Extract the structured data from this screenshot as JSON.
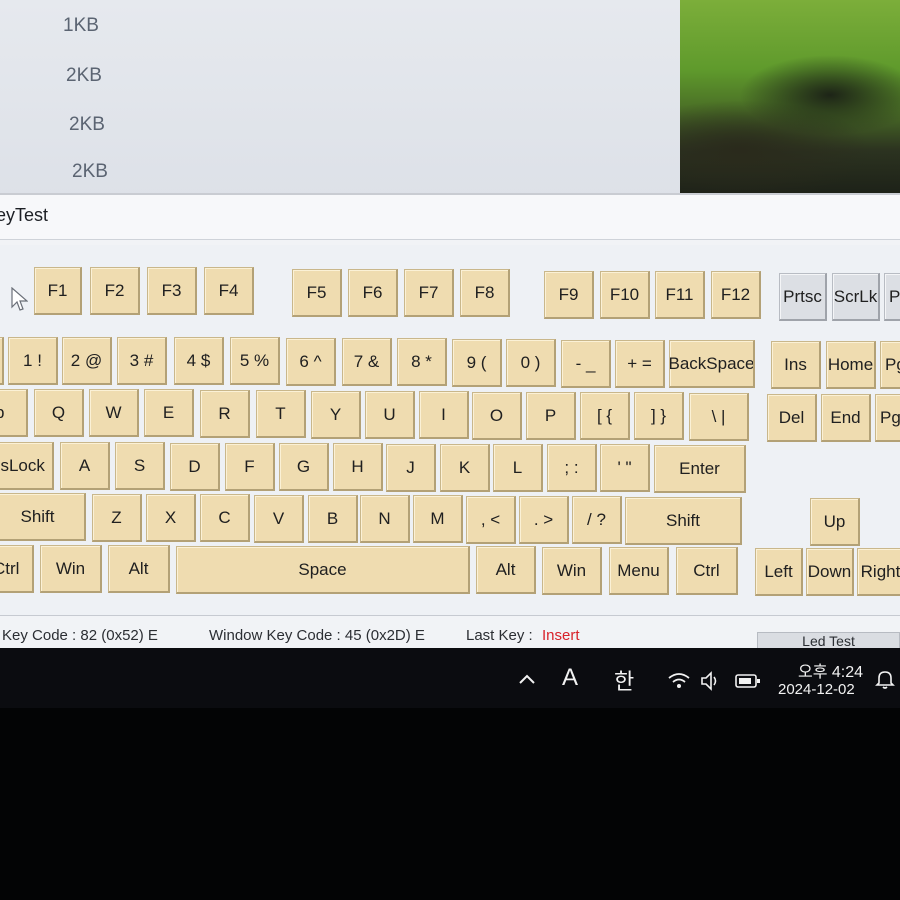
{
  "file_list": {
    "sizes": [
      "1KB",
      "2KB",
      "2KB",
      "2KB"
    ]
  },
  "window": {
    "title": "eyTest"
  },
  "keyboard": {
    "function_row": [
      "F1",
      "F2",
      "F3",
      "F4",
      "F5",
      "F6",
      "F7",
      "F8",
      "F9",
      "F10",
      "F11",
      "F12"
    ],
    "system_keys": [
      "Prtsc",
      "ScrLk",
      "Pa"
    ],
    "number_row": [
      "!",
      "1 !",
      "2 @",
      "3 #",
      "4 $",
      "5 %",
      "6 ^",
      "7 &",
      "8 *",
      "9 (",
      "0 )",
      "- _",
      "+ =",
      "BackSpace"
    ],
    "nav_top": [
      "Ins",
      "Home",
      "Pg"
    ],
    "qwerty_row": [
      "b",
      "Q",
      "W",
      "E",
      "R",
      "T",
      "Y",
      "U",
      "I",
      "O",
      "P",
      "[ {",
      "] }",
      "\\ |"
    ],
    "nav_mid": [
      "Del",
      "End",
      "Pgl"
    ],
    "home_row": [
      "osLock",
      "A",
      "S",
      "D",
      "F",
      "G",
      "H",
      "J",
      "K",
      "L",
      "; :",
      "' \"",
      "Enter"
    ],
    "shift_row": [
      "Shift",
      "Z",
      "X",
      "C",
      "V",
      "B",
      "N",
      "M",
      ", <",
      ". >",
      "/ ?",
      "Shift"
    ],
    "arrow_up": "Up",
    "bottom_row": [
      "Ctrl",
      "Win",
      "Alt",
      "Space",
      "Alt",
      "Win",
      "Menu",
      "Ctrl"
    ],
    "arrow_bottom": [
      "Left",
      "Down",
      "Right"
    ]
  },
  "status": {
    "key_code_label": "Key Code : 82 (0x52) E",
    "window_key_code_label": "Window Key Code : 45 (0x2D) E",
    "last_key_label": "Last Key :",
    "last_key_value": "Insert",
    "led_test_label": "Led Test"
  },
  "taskbar": {
    "input_mode": "A",
    "ime_lang": "한",
    "time": "오후 4:24",
    "date": "2024-12-02"
  },
  "colors": {
    "key_face": "#efdcb0",
    "system_key_face": "#dcdfe4",
    "last_key_value": "#d8222a",
    "taskbar": "#0b0c10"
  }
}
